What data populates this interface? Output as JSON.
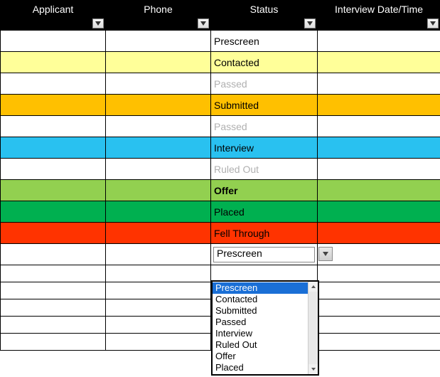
{
  "headers": {
    "applicant": "Applicant",
    "phone": "Phone",
    "status": "Status",
    "interview": "Interview Date/Time"
  },
  "chart_data": {
    "type": "table",
    "columns": [
      "Applicant",
      "Phone",
      "Status",
      "Interview Date/Time"
    ],
    "rows": [
      {
        "applicant": "",
        "phone": "",
        "status": "Prescreen",
        "interview": "",
        "style": "white"
      },
      {
        "applicant": "",
        "phone": "",
        "status": "Contacted",
        "interview": "",
        "style": "yellow"
      },
      {
        "applicant": "",
        "phone": "",
        "status": "Passed",
        "interview": "",
        "style": "grey"
      },
      {
        "applicant": "",
        "phone": "",
        "status": "Submitted",
        "interview": "",
        "style": "orange"
      },
      {
        "applicant": "",
        "phone": "",
        "status": "Passed",
        "interview": "",
        "style": "grey"
      },
      {
        "applicant": "",
        "phone": "",
        "status": "Interview",
        "interview": "",
        "style": "cyan"
      },
      {
        "applicant": "",
        "phone": "",
        "status": "Ruled Out",
        "interview": "",
        "style": "ruled"
      },
      {
        "applicant": "",
        "phone": "",
        "status": "Offer",
        "interview": "",
        "style": "offer"
      },
      {
        "applicant": "",
        "phone": "",
        "status": "Placed",
        "interview": "",
        "style": "placed"
      },
      {
        "applicant": "",
        "phone": "",
        "status": "Fell Through",
        "interview": "",
        "style": "fell"
      },
      {
        "applicant": "",
        "phone": "",
        "status": "Prescreen",
        "interview": "",
        "style": "white",
        "active": true
      }
    ]
  },
  "dropdown": {
    "selected_index": 0,
    "options": [
      "Prescreen",
      "Contacted",
      "Submitted",
      "Passed",
      "Interview",
      "Ruled Out",
      "Offer",
      "Placed"
    ]
  },
  "row_colors": {
    "white": "#ffffff",
    "yellow": "#ffff99",
    "orange": "#ffc000",
    "cyan": "#29c1f0",
    "offer": "#92d050",
    "placed": "#00b050",
    "fell": "#ff3300"
  }
}
